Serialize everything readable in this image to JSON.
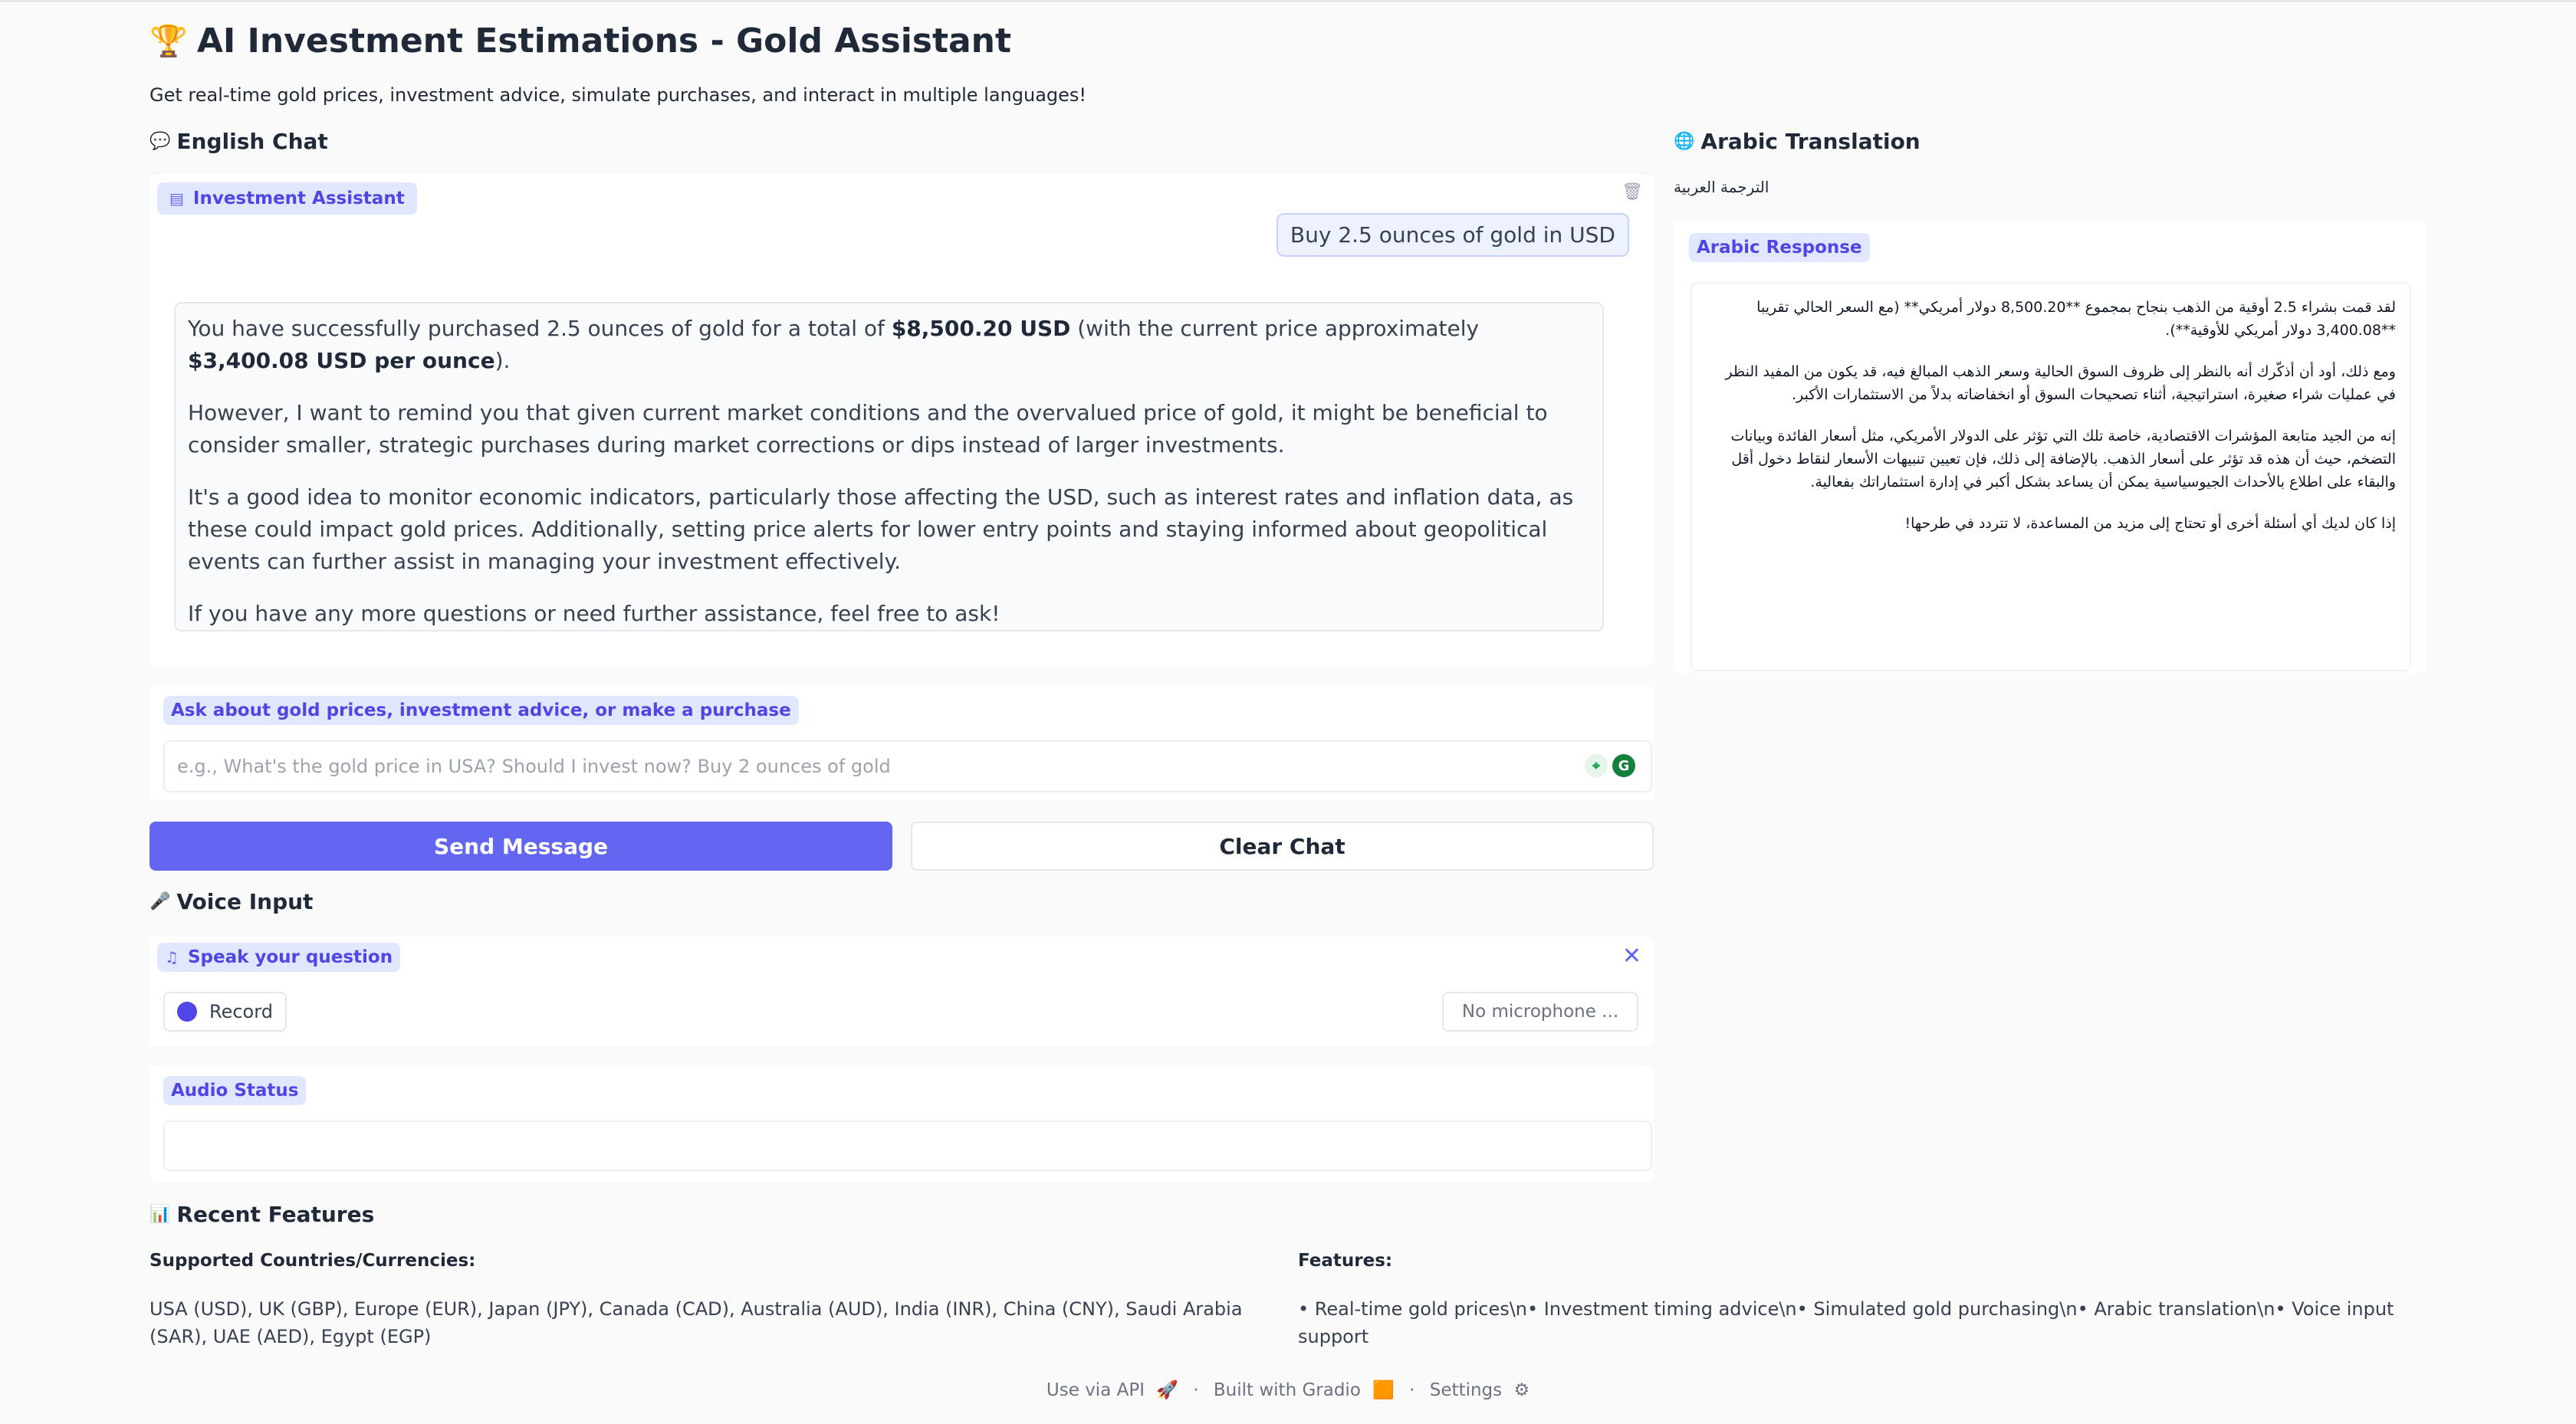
{
  "header": {
    "icon": "trophy-icon",
    "title": "AI Investment Estimations - Gold Assistant",
    "subtitle": "Get real-time gold prices, investment advice, simulate purchases, and interact in multiple languages!"
  },
  "english_chat": {
    "heading": "English Chat",
    "chatbot_label": "Investment Assistant",
    "user_message": "Buy 2.5 ounces of gold in USD",
    "assistant_message": {
      "p1_a": "You have successfully purchased 2.5 ounces of gold for a total of ",
      "p1_b": "$8,500.20 USD",
      "p1_c": " (with the current price approximately ",
      "p1_d": "$3,400.08 USD per ounce",
      "p1_e": ").",
      "p2": "However, I want to remind you that given current market conditions and the overvalued price of gold, it might be beneficial to consider smaller, strategic purchases during market corrections or dips instead of larger investments.",
      "p3": "It's a good idea to monitor economic indicators, particularly those affecting the USD, such as interest rates and inflation data, as these could impact gold prices. Additionally, setting price alerts for lower entry points and staying informed about geopolitical events can further assist in managing your investment effectively.",
      "p4": "If you have any more questions or need further assistance, feel free to ask!"
    }
  },
  "arabic": {
    "heading": "Arabic Translation",
    "subheading": "الترجمة العربية",
    "box_label": "Arabic Response",
    "paragraphs": [
      "لقد قمت بشراء 2.5 أوقية من الذهب بنجاح بمجموع **8,500.20 دولار أمريكي** (مع السعر الحالي تقريبا **3,400.08 دولار أمريكي للأوقية**).",
      "ومع ذلك، أود أن أذكّرك أنه بالنظر إلى ظروف السوق الحالية وسعر الذهب المبالغ فيه، قد يكون من المفيد النظر في عمليات شراء صغيرة، استراتيجية، أثناء تصحيحات السوق أو انخفاضاته بدلاً من الاستثمارات الأكبر.",
      "إنه من الجيد متابعة المؤشرات الاقتصادية، خاصة تلك التي تؤثر على الدولار الأمريكي، مثل أسعار الفائدة وبيانات التضخم، حيث أن هذه قد تؤثر على أسعار الذهب. بالإضافة إلى ذلك، فإن تعيين تنبيهات الأسعار لنقاط دخول أقل والبقاء على اطلاع بالأحداث الجيوسياسية يمكن أن يساعد بشكل أكبر في إدارة استثماراتك بفعالية.",
      "إذا كان لديك أي أسئلة أخرى أو تحتاج إلى مزيد من المساعدة، لا تتردد في طرحها!"
    ]
  },
  "ask": {
    "label": "Ask about gold prices, investment advice, or make a purchase",
    "placeholder": "e.g., What's the gold price in USA? Should I invest now? Buy 2 ounces of gold"
  },
  "buttons": {
    "send": "Send Message",
    "clear": "Clear Chat"
  },
  "voice": {
    "heading": "Voice Input",
    "label": "Speak your question",
    "record": "Record",
    "microphone": "No microphone ..."
  },
  "audio_status": {
    "label": "Audio Status",
    "value": ""
  },
  "features": {
    "heading": "Recent Features",
    "countries_label": "Supported Countries/Currencies:",
    "countries_text": "USA (USD), UK (GBP), Europe (EUR), Japan (JPY), Canada (CAD), Australia (AUD), India (INR), China (CNY), Saudi Arabia (SAR), UAE (AED), Egypt (EGP)",
    "features_label": "Features:",
    "features_text": "• Real-time gold prices\\n• Investment timing advice\\n• Simulated gold purchasing\\n• Arabic translation\\n• Voice input support"
  },
  "footer": {
    "api": "Use via API",
    "built": "Built with Gradio",
    "settings": "Settings"
  },
  "colors": {
    "accent": "#6366f1",
    "pill_bg": "#e0e7ff",
    "page_bg": "#fafafb"
  }
}
